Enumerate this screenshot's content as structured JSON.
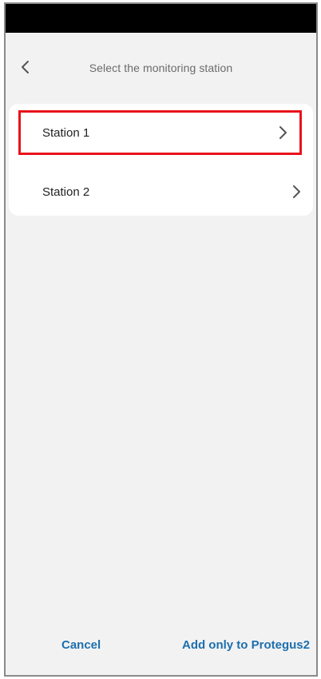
{
  "header": {
    "title": "Select the monitoring station",
    "back_icon": "chevron-left-icon"
  },
  "stations": [
    {
      "label": "Station 1",
      "icon": "chevron-right-icon",
      "highlighted": true
    },
    {
      "label": "Station 2",
      "icon": "chevron-right-icon",
      "highlighted": false
    }
  ],
  "footer": {
    "cancel_label": "Cancel",
    "add_label": "Add only to Protegus2"
  },
  "colors": {
    "accent": "#1d6fae",
    "highlight_border": "#e8131b",
    "background": "#f2f2f2",
    "status_bar": "#000000"
  }
}
